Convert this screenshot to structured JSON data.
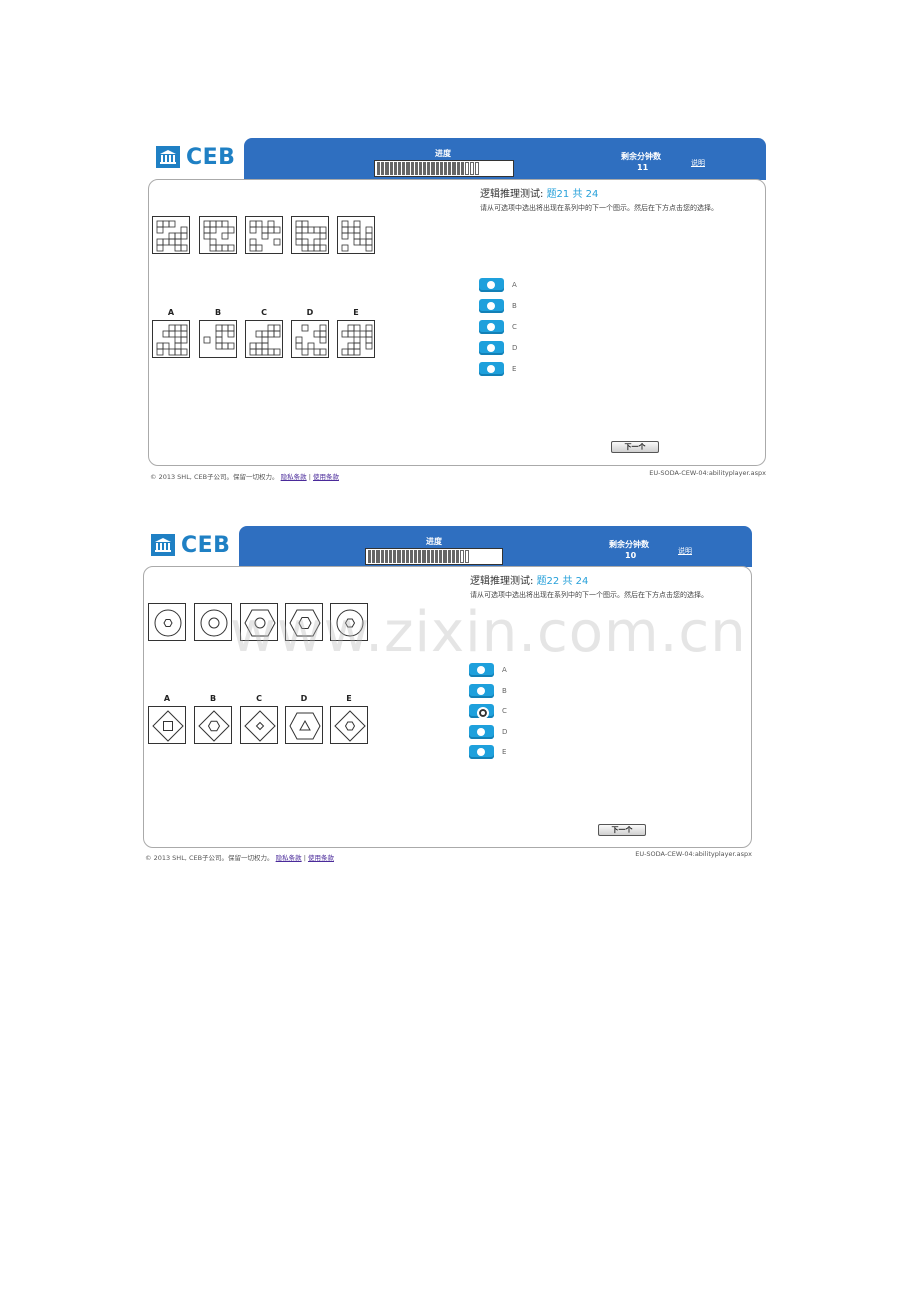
{
  "brand": {
    "logo_text": "CEB",
    "logo_color": "#1f80c4",
    "banner_color": "#2f6fc0"
  },
  "screens": [
    {
      "progress_label": "进度",
      "progress": {
        "filled": 21,
        "total": 24
      },
      "timer_label": "剩余分钟数",
      "timer_value": "11",
      "help_link": "说明",
      "question_prefix": "逻辑推理测试:",
      "question_counter": "题21 共 24",
      "instruction": "请从可选项中选出将出现在系列中的下一个图示。然后在下方点击您的选择。",
      "option_letters": [
        "A",
        "B",
        "C",
        "D",
        "E"
      ],
      "radio_options": [
        "A",
        "B",
        "C",
        "D",
        "E"
      ],
      "selected": null,
      "next_button": "下一个",
      "footer_copyright": "© 2013 SHL, CEB子公司。保留一切权力。",
      "footer_link_privacy": "隐私条款",
      "footer_separator": "|",
      "footer_link_terms": "使用条款",
      "footer_page": "EU-SODA-CEW-04:abilityplayer.aspx"
    },
    {
      "progress_label": "进度",
      "progress": {
        "filled": 22,
        "total": 24
      },
      "timer_label": "剩余分钟数",
      "timer_value": "10",
      "help_link": "说明",
      "question_prefix": "逻辑推理测试:",
      "question_counter": "题22 共 24",
      "instruction": "请从可选项中选出将出现在系列中的下一个图示。然后在下方点击您的选择。",
      "option_letters": [
        "A",
        "B",
        "C",
        "D",
        "E"
      ],
      "radio_options": [
        "A",
        "B",
        "C",
        "D",
        "E"
      ],
      "selected": "C",
      "next_button": "下一个",
      "footer_copyright": "© 2013 SHL, CEB子公司。保留一切权力。",
      "footer_link_privacy": "隐私条款",
      "footer_separator": "|",
      "footer_link_terms": "使用条款",
      "footer_page": "EU-SODA-CEW-04:abilityplayer.aspx"
    }
  ],
  "watermark": "www.zixin.com.cn"
}
